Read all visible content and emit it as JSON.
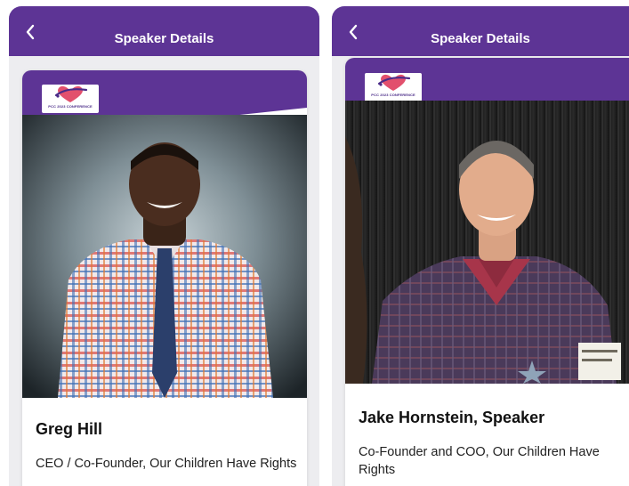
{
  "screens": [
    {
      "nav_title": "Speaker Details",
      "logo_text": "PCC 2023 CONFERENCE",
      "speaker_name": "Greg Hill",
      "speaker_role": "CEO / Co-Founder, Our Children Have Rights"
    },
    {
      "nav_title": "Speaker Details",
      "logo_text": "PCC 2023 CONFERENCE",
      "speaker_name": "Jake Hornstein, Speaker",
      "speaker_role": "Co-Founder and COO, Our Children Have Rights"
    }
  ],
  "colors": {
    "brand_purple": "#5d3495",
    "background": "#ededf0",
    "card": "#ffffff",
    "text": "#111111"
  },
  "icons": {
    "back": "chevron-left-icon",
    "logo": "heart-logo-icon"
  }
}
